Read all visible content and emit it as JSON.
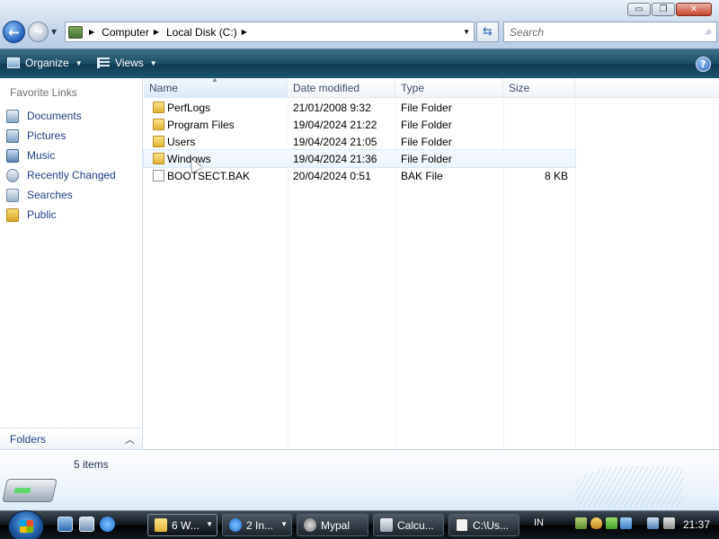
{
  "window": {
    "controls": {
      "minimize": "▭",
      "maximize": "❐",
      "close": "✕"
    }
  },
  "address_bar": {
    "crumbs": [
      "Computer",
      "Local Disk (C:)"
    ],
    "search_placeholder": "Search"
  },
  "command_bar": {
    "organize": "Organize",
    "views": "Views",
    "help": "?"
  },
  "nav_pane": {
    "heading": "Favorite Links",
    "links": [
      {
        "label": "Documents",
        "icon": "documents-icon"
      },
      {
        "label": "Pictures",
        "icon": "pictures-icon"
      },
      {
        "label": "Music",
        "icon": "music-icon"
      },
      {
        "label": "Recently Changed",
        "icon": "recently-changed-icon"
      },
      {
        "label": "Searches",
        "icon": "searches-icon"
      },
      {
        "label": "Public",
        "icon": "public-folder-icon"
      }
    ],
    "folders_label": "Folders"
  },
  "file_list": {
    "columns": {
      "name": "Name",
      "date": "Date modified",
      "type": "Type",
      "size": "Size"
    },
    "rows": [
      {
        "name": "PerfLogs",
        "date": "21/01/2008 9:32",
        "type": "File Folder",
        "size": "",
        "icon": "folder-icon"
      },
      {
        "name": "Program Files",
        "date": "19/04/2024 21:22",
        "type": "File Folder",
        "size": "",
        "icon": "folder-icon"
      },
      {
        "name": "Users",
        "date": "19/04/2024 21:05",
        "type": "File Folder",
        "size": "",
        "icon": "folder-icon"
      },
      {
        "name": "Windows",
        "date": "19/04/2024 21:36",
        "type": "File Folder",
        "size": "",
        "icon": "folder-icon"
      },
      {
        "name": "BOOTSECT.BAK",
        "date": "20/04/2024 0:51",
        "type": "BAK File",
        "size": "8 KB",
        "icon": "file-icon"
      }
    ]
  },
  "details_pane": {
    "item_count": "5 items"
  },
  "taskbar": {
    "buttons": [
      {
        "label": "6 W...",
        "icon": "explorer-folder-icon",
        "grouped": true
      },
      {
        "label": "2 In...",
        "icon": "internet-explorer-icon",
        "grouped": true
      },
      {
        "label": "Mypal",
        "icon": "mypal-icon",
        "grouped": false
      },
      {
        "label": "Calcu...",
        "icon": "calculator-icon",
        "grouped": false
      },
      {
        "label": "C:\\Us...",
        "icon": "7zip-icon",
        "grouped": false
      }
    ],
    "language": "IN",
    "clock": "21:37"
  }
}
